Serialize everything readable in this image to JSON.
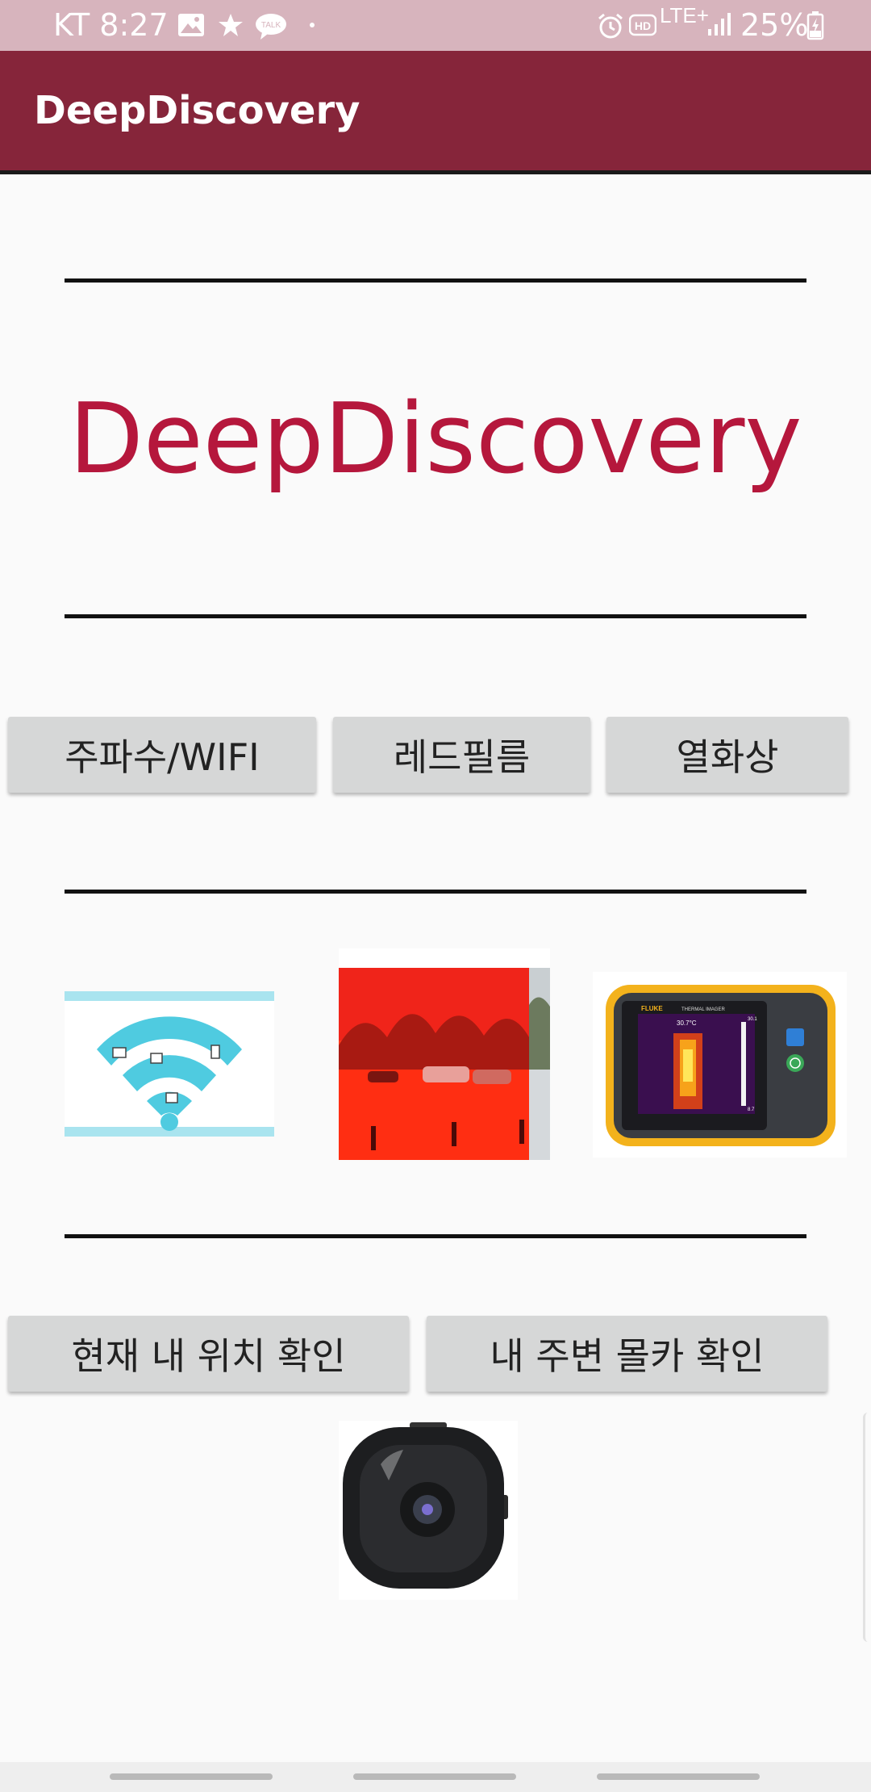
{
  "status_bar": {
    "carrier": "KT",
    "time": "8:27",
    "network": "LTE+",
    "battery": "25%",
    "icons": [
      "gallery-icon",
      "star-icon",
      "kakaotalk-icon",
      "dot-icon",
      "alarm-icon",
      "hd-icon",
      "lte-icon",
      "signal-icon",
      "battery-icon"
    ],
    "talk_badge": "TALK",
    "hd_badge": "HD"
  },
  "app_bar": {
    "title": "DeepDiscovery",
    "color": "#86253a"
  },
  "main": {
    "heading": "DeepDiscovery",
    "heading_color": "#b5173c",
    "mode_buttons": [
      {
        "label": "주파수/WIFI"
      },
      {
        "label": "레드필름"
      },
      {
        "label": "열화상"
      }
    ],
    "thermal_device": {
      "brand": "FLUKE",
      "model": "THERMAL IMAGER",
      "temperature": "30.7°C",
      "scale_max": "30.1",
      "scale_min": "8.7"
    },
    "action_buttons": [
      {
        "label": "현재 내 위치 확인"
      },
      {
        "label": "내 주변 몰카 확인"
      }
    ]
  }
}
